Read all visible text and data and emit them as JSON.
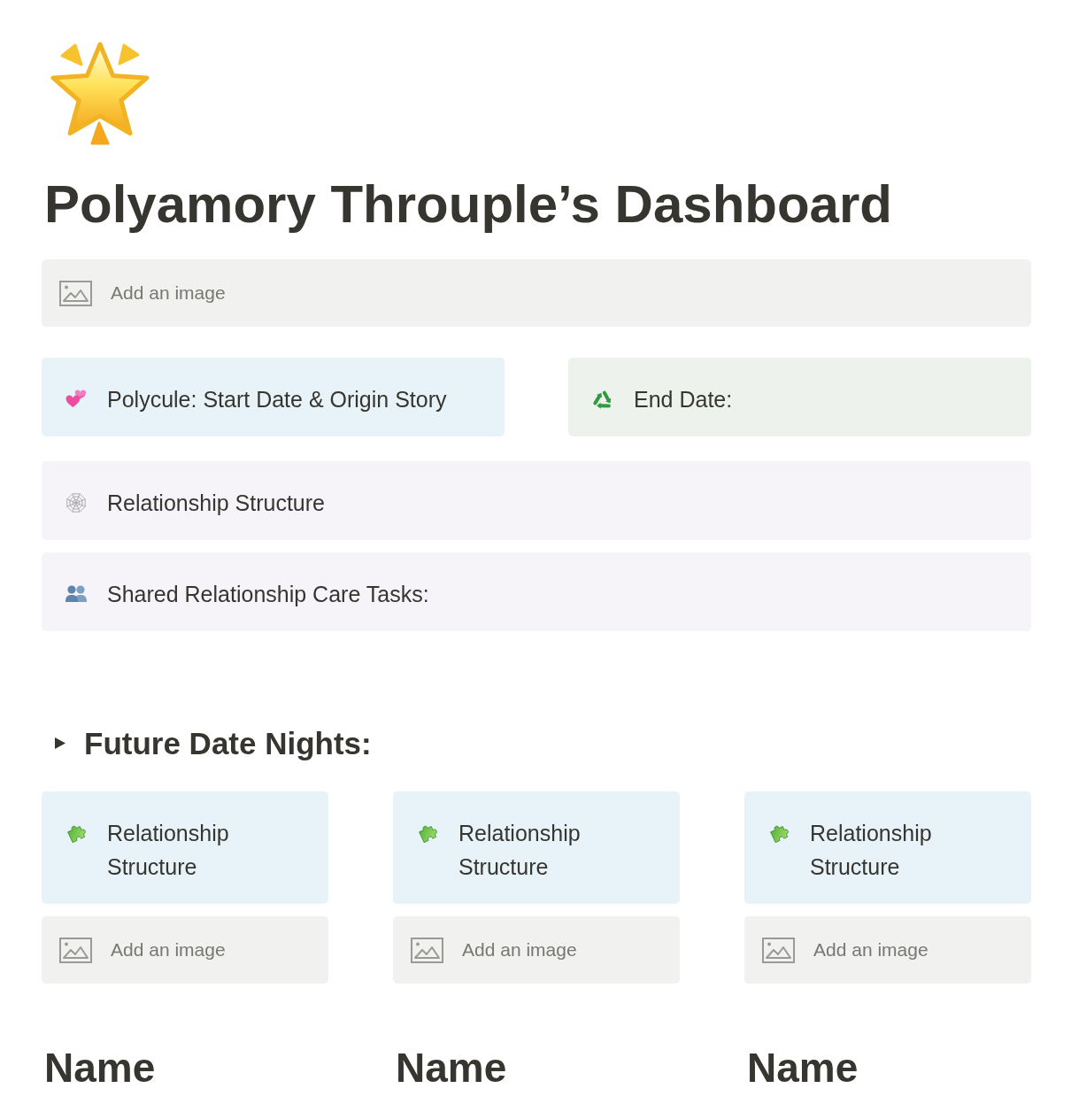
{
  "title": "Polyamory Throuple’s Dashboard",
  "image_block": {
    "label": "Add an image"
  },
  "callout_row": [
    {
      "text": "Polycule: Start Date & Origin Story",
      "color": "#e7f3f8"
    },
    {
      "text": "End Date:",
      "color": "#edf3ec"
    }
  ],
  "callouts": [
    {
      "text": "Relationship Structure",
      "color": "#f6f3f9"
    },
    {
      "text": "Shared Relationship Care Tasks:",
      "color": "#f6f3f9"
    }
  ],
  "toggle_heading": {
    "text": "Future Date Nights:",
    "expanded": false
  },
  "columns": [
    {
      "callout": {
        "text": "Relationship Structure",
        "color": "#e7f3f8"
      },
      "image_block": {
        "label": "Add an image"
      },
      "heading": "Name"
    },
    {
      "callout": {
        "text": "Relationship Structure",
        "color": "#e7f3f8"
      },
      "image_block": {
        "label": "Add an image"
      },
      "heading": "Name"
    },
    {
      "callout": {
        "text": "Relationship Structure",
        "color": "#e7f3f8"
      },
      "image_block": {
        "label": "Add an image"
      },
      "heading": "Name"
    }
  ]
}
